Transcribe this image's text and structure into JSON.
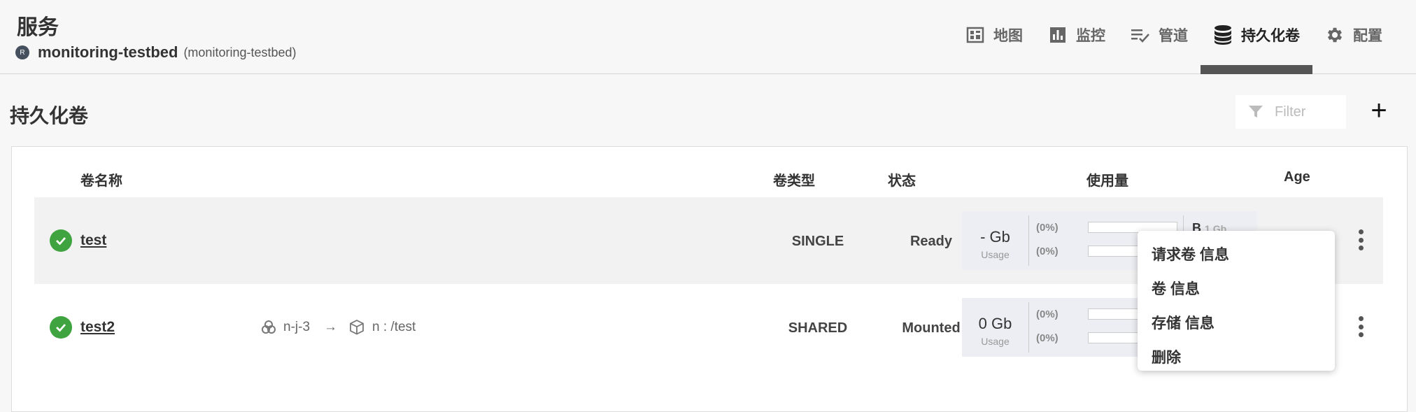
{
  "header": {
    "title": "服务",
    "project_icon_text": "R",
    "project_name": "monitoring-testbed",
    "project_sub": "(monitoring-testbed)"
  },
  "nav": {
    "tabs": [
      {
        "label": "地图",
        "icon": "map-icon"
      },
      {
        "label": "监控",
        "icon": "bar-chart-icon"
      },
      {
        "label": "管道",
        "icon": "pipeline-list-icon"
      },
      {
        "label": "持久化卷",
        "icon": "database-icon",
        "active": true
      },
      {
        "label": "配置",
        "icon": "gear-icon"
      }
    ]
  },
  "section": {
    "title": "持久化卷",
    "filter_placeholder": "Filter",
    "add_label": "+"
  },
  "table": {
    "headers": {
      "name": "卷名称",
      "type": "卷类型",
      "state": "状态",
      "usage": "使用量",
      "age": "Age"
    },
    "rows": [
      {
        "name": "test",
        "type": "SINGLE",
        "state": "Ready",
        "usage_value": "- Gb",
        "usage_label": "Usage",
        "pct1": "(0%)",
        "pct2": "(0%)",
        "cap_main": "B",
        "cap_sub": "1 Gb"
      },
      {
        "name": "test2",
        "node": "n-j-3",
        "arrow": "→",
        "mount": "n : /test",
        "type": "SHARED",
        "state": "Mounted",
        "usage_value": "0 Gb",
        "usage_label": "Usage",
        "pct1": "(0%)",
        "pct2": "(0%)"
      }
    ]
  },
  "menu": {
    "items": [
      "请求卷 信息",
      "卷 信息",
      "存储 信息",
      "删除"
    ]
  },
  "colors": {
    "status_ok": "#3fa33f",
    "active_tab_indicator": "#555555"
  }
}
